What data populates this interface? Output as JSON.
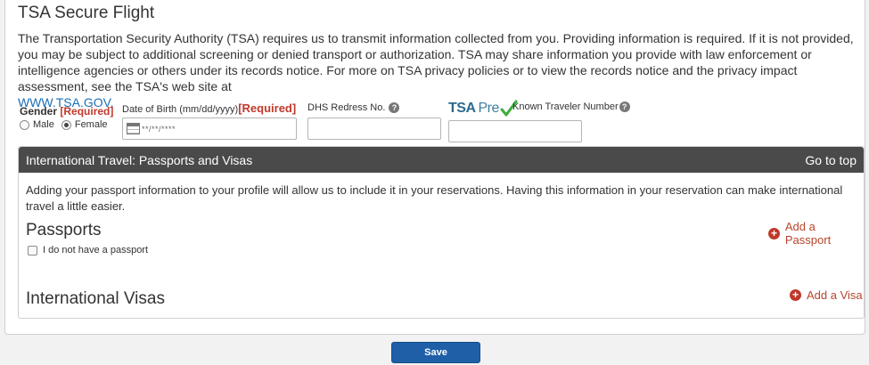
{
  "tsa": {
    "title": "TSA Secure Flight",
    "description": "The Transportation Security Authority (TSA) requires us to transmit information collected from you. Providing information is required. If it is not provided, you may be subject to additional screening or denied transport or authorization. TSA may share information you provide with law enforcement or intelligence agencies or others under its records notice. For more on TSA privacy policies or to view the records notice and the privacy impact assessment, see the TSA's web site at",
    "link_text": "WWW.TSA.GOV.",
    "gender_label": "Gender",
    "required_text": "[Required]",
    "gender_options": {
      "male": "Male",
      "female": "Female",
      "selected": "Female"
    },
    "dob_label": "Date of Birth (mm/dd/yyyy)",
    "dob_placeholder": "**/**/****",
    "redress_label": "DHS Redress No.",
    "tsa_pre_logo_tsa": "TSA",
    "tsa_pre_logo_pre": "Pre",
    "ktn_label": "Known Traveler Number",
    "help_glyph": "?"
  },
  "international": {
    "header_title": "International Travel: Passports and Visas",
    "go_to_top": "Go to top",
    "description": "Adding your passport information to your profile will allow us to include it in your reservations. Having this information in your reservation can make international travel a little easier.",
    "passports_title": "Passports",
    "add_passport": "Add a Passport",
    "no_passport_label": "I do not have a passport",
    "visas_title": "International Visas",
    "add_visa": "Add a Visa",
    "plus_glyph": "+"
  },
  "actions": {
    "save_label": "Save"
  },
  "colors": {
    "header_bg": "#4a4a4a",
    "required_red": "#c0392b",
    "link_blue": "#1a6fb5",
    "save_blue": "#1f5fa8",
    "check_green": "#3cae3c"
  }
}
